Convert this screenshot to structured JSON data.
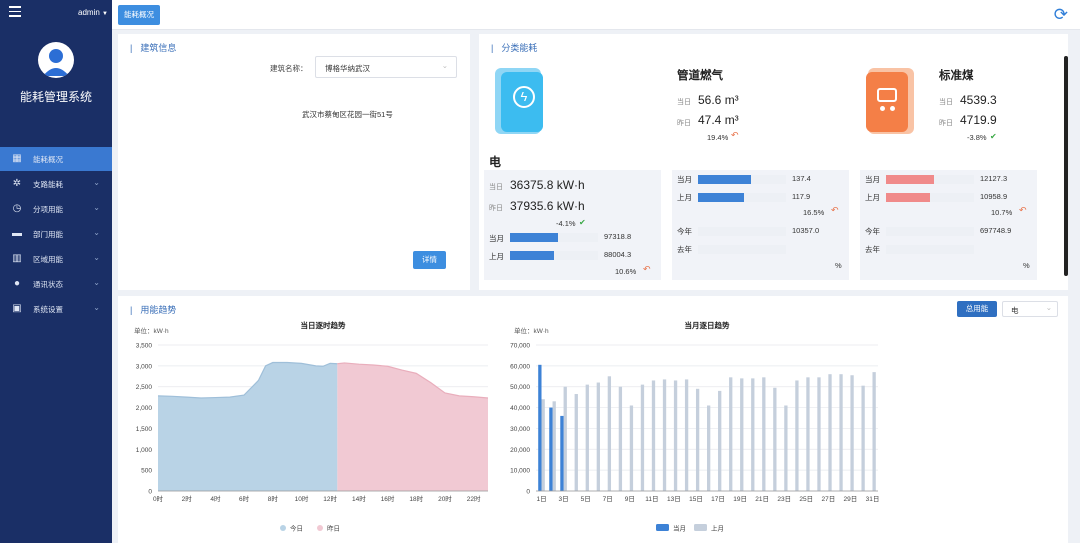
{
  "sidebar": {
    "user": "admin",
    "system_title": "能耗管理系统",
    "items": [
      {
        "label": "能耗概况",
        "icon": "building-icon",
        "active": true
      },
      {
        "label": "支路能耗",
        "icon": "branch-icon"
      },
      {
        "label": "分项用能",
        "icon": "clock-icon"
      },
      {
        "label": "部门用能",
        "icon": "folder-icon"
      },
      {
        "label": "区域用能",
        "icon": "region-icon"
      },
      {
        "label": "通讯状态",
        "icon": "location-pin-icon"
      },
      {
        "label": "系统设置",
        "icon": "settings-icon"
      }
    ]
  },
  "topbar": {
    "active_tab": "能耗概况"
  },
  "building": {
    "title": "建筑信息",
    "name_label": "建筑名称：",
    "name_value": "博格华纳武汉",
    "address": "武汉市蔡甸区花园一街51号",
    "detail_button": "详情"
  },
  "category": {
    "title": "分类能耗",
    "electric": {
      "name": "电",
      "today_label": "当日",
      "today_value": "36375.8 kW·h",
      "yesterday_label": "昨日",
      "yesterday_value": "37935.6 kW·h",
      "change": "-4.1%",
      "month_label": "当月",
      "month_value": "97318.8",
      "month_fill": 0.55,
      "lastmonth_label": "上月",
      "lastmonth_value": "88004.3",
      "lastmonth_fill": 0.5,
      "month_change": "10.6%"
    },
    "gas": {
      "name": "管道燃气",
      "today_label": "当日",
      "today_value": "56.6 m³",
      "yesterday_label": "昨日",
      "yesterday_value": "47.4 m³",
      "change": "19.4%",
      "month_label": "当月",
      "month_value": "137.4",
      "month_fill": 0.6,
      "lastmonth_label": "上月",
      "lastmonth_value": "117.9",
      "lastmonth_fill": 0.52,
      "month_change": "16.5%",
      "year_label": "今年",
      "year_value": "10357.0",
      "lastyear_label": "去年",
      "percent": "%"
    },
    "coal": {
      "name": "标准煤",
      "today_label": "当日",
      "today_value": "4539.3",
      "yesterday_label": "昨日",
      "yesterday_value": "4719.9",
      "change": "-3.8%",
      "month_label": "当月",
      "month_value": "12127.3",
      "month_fill": 0.55,
      "lastmonth_label": "上月",
      "lastmonth_value": "10958.9",
      "lastmonth_fill": 0.5,
      "month_change": "10.7%",
      "year_label": "今年",
      "year_value": "697748.9",
      "lastyear_label": "去年",
      "percent": "%"
    }
  },
  "trend": {
    "title": "用能趋势",
    "total_button": "总用能",
    "select_value": "电"
  },
  "colors": {
    "today": "#b9d3e6",
    "yesterday": "#f1c9d3",
    "current_month": "#3d82d6",
    "last_month": "#c5cfdc"
  },
  "chart_data": [
    {
      "type": "area",
      "title": "当日逐时趋势",
      "unit_label": "单位：kW·h",
      "ylim": [
        0,
        3500
      ],
      "yticks": [
        "0",
        "500",
        "1,000",
        "1,500",
        "2,000",
        "2,500",
        "3,000",
        "3,500"
      ],
      "xticks": [
        "0时",
        "2时",
        "4时",
        "6时",
        "8时",
        "10时",
        "12时",
        "14时",
        "16时",
        "18时",
        "20时",
        "22时"
      ],
      "series": [
        {
          "name": "今日",
          "x": [
            0,
            1,
            2,
            3,
            4,
            5,
            6,
            7,
            7.5,
            8,
            9,
            10,
            11,
            11.5,
            12,
            12.5
          ],
          "y": [
            2280,
            2270,
            2250,
            2230,
            2240,
            2250,
            2300,
            2650,
            3000,
            3080,
            3080,
            3060,
            3000,
            2990,
            3060,
            3050
          ]
        },
        {
          "name": "昨日",
          "x": [
            12.5,
            13,
            14,
            15,
            16,
            17,
            18,
            19,
            20,
            21,
            22,
            23
          ],
          "y": [
            3050,
            3070,
            3040,
            3020,
            2990,
            2900,
            2820,
            2600,
            2350,
            2280,
            2260,
            2230
          ]
        }
      ],
      "legend": [
        "今日",
        "昨日"
      ]
    },
    {
      "type": "bar",
      "title": "当月逐日趋势",
      "unit_label": "单位：kW·h",
      "ylim": [
        0,
        70000
      ],
      "yticks": [
        "0",
        "10,000",
        "20,000",
        "30,000",
        "40,000",
        "50,000",
        "60,000",
        "70,000"
      ],
      "categories": [
        "1日",
        "2日",
        "3日",
        "4日",
        "5日",
        "6日",
        "7日",
        "8日",
        "9日",
        "10日",
        "11日",
        "12日",
        "13日",
        "14日",
        "15日",
        "16日",
        "17日",
        "18日",
        "19日",
        "20日",
        "21日",
        "22日",
        "23日",
        "24日",
        "25日",
        "26日",
        "27日",
        "28日",
        "29日",
        "30日",
        "31日"
      ],
      "xticks": [
        "1日",
        "3日",
        "5日",
        "7日",
        "9日",
        "11日",
        "13日",
        "15日",
        "17日",
        "19日",
        "21日",
        "23日",
        "25日",
        "27日",
        "29日",
        "31日"
      ],
      "series": [
        {
          "name": "当月",
          "values": [
            60500,
            40000,
            36000
          ]
        },
        {
          "name": "上月",
          "values": [
            44000,
            43000,
            50000,
            46500,
            51000,
            52000,
            55000,
            50000,
            41000,
            51000,
            53000,
            53500,
            53000,
            53500,
            49000,
            41000,
            48000,
            54500,
            54000,
            54000,
            54500,
            49500,
            41000,
            53000,
            54500,
            54500,
            56000,
            56000,
            55500,
            50500,
            57000
          ]
        }
      ],
      "legend": [
        "当月",
        "上月"
      ]
    }
  ]
}
